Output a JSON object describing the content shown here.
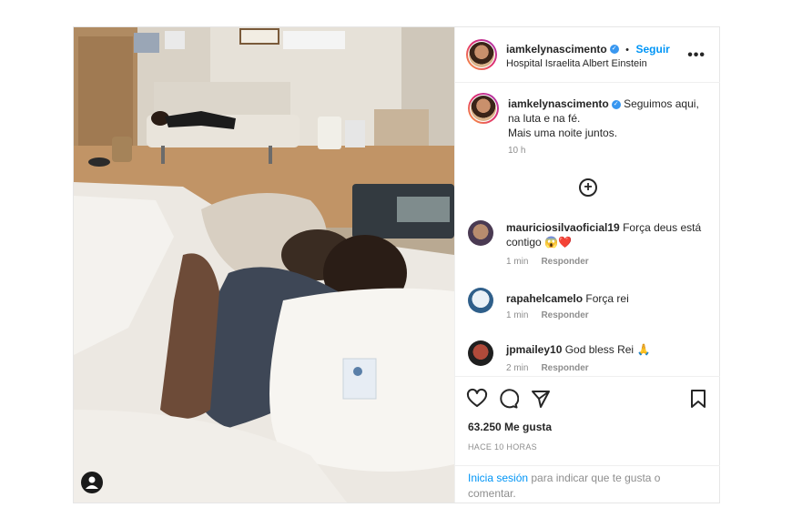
{
  "post": {
    "author": "iamkelynascimento",
    "location": "Hospital Israelita Albert Einstein",
    "follow_label": "Seguir",
    "separator": "•",
    "more_label": "•••",
    "verified_glyph": "✓",
    "caption_line1": "Seguimos aqui, na luta e na fé.",
    "caption_line2": "Mais uma noite juntos.",
    "caption_time": "10 h",
    "load_more_glyph": "+",
    "likes": "63.250 Me gusta",
    "posted_ago": "HACE 10 HORAS",
    "login_link": "Inicia sesión",
    "login_text": " para indicar que te gusta o comentar."
  },
  "comments": [
    {
      "user": "mauriciosilvaoficial19",
      "text": "Força deus está contigo",
      "emoji": "😱❤️",
      "time": "1 min",
      "reply": "Responder"
    },
    {
      "user": "rapahelcamelo",
      "text": "Força rei",
      "emoji": "",
      "time": "1 min",
      "reply": "Responder"
    },
    {
      "user": "jpmailey10",
      "text": "God bless Rei",
      "emoji": "🙏",
      "time": "2 min",
      "reply": "Responder"
    }
  ],
  "icons": {
    "like": "heart-icon",
    "comment": "comment-bubble-icon",
    "share": "paper-plane-icon",
    "save": "bookmark-icon",
    "tag": "user-tag-icon"
  },
  "colors": {
    "link": "#0095f6",
    "verified": "#3897f0",
    "muted": "#8e8e8e",
    "heart": "#ed4956"
  }
}
